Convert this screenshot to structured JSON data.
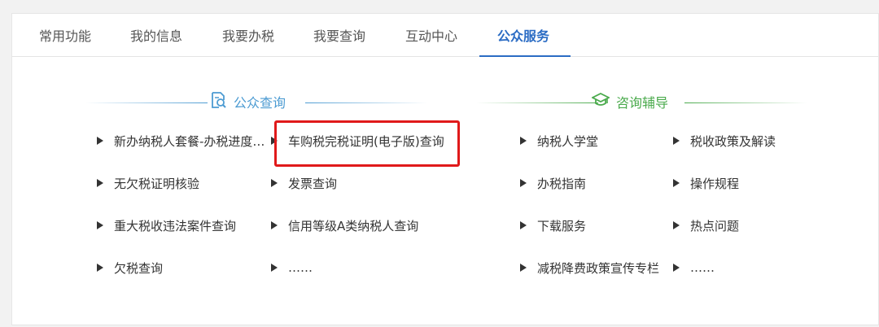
{
  "tabs": [
    {
      "label": "常用功能"
    },
    {
      "label": "我的信息"
    },
    {
      "label": "我要办税"
    },
    {
      "label": "我要查询"
    },
    {
      "label": "互动中心"
    },
    {
      "label": "公众服务",
      "active": true
    }
  ],
  "public_query": {
    "title": "公众查询",
    "icon": "search-doc-icon",
    "color": "#4c9bd2",
    "left_items": [
      {
        "label": "新办纳税人套餐-办税进度…"
      },
      {
        "label": "无欠税证明核验"
      },
      {
        "label": "重大税收违法案件查询"
      },
      {
        "label": "欠税查询"
      }
    ],
    "right_items": [
      {
        "label": "车购税完税证明(电子版)查询"
      },
      {
        "label": "发票查询"
      },
      {
        "label": "信用等级A类纳税人查询"
      },
      {
        "label": "……"
      }
    ]
  },
  "consult_guide": {
    "title": "咨询辅导",
    "icon": "graduation-cap-icon",
    "color": "#4aaa4c",
    "left_items": [
      {
        "label": "纳税人学堂"
      },
      {
        "label": "办税指南"
      },
      {
        "label": "下载服务"
      },
      {
        "label": "减税降费政策宣传专栏"
      }
    ],
    "right_items": [
      {
        "label": "税收政策及解读"
      },
      {
        "label": "操作规程"
      },
      {
        "label": "热点问题"
      },
      {
        "label": "……"
      }
    ]
  },
  "colors": {
    "active_tab": "#2b6cc4",
    "highlight_box": "#e0191a"
  }
}
